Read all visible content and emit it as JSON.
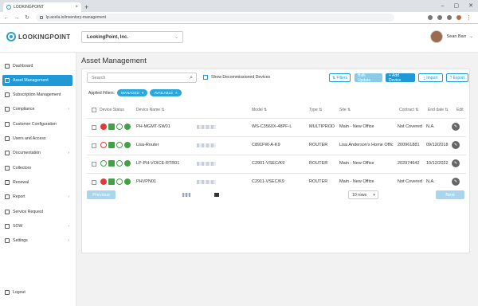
{
  "browser": {
    "tab_title": "LOOKINGPOINT",
    "url": "lp.acela.io/inventory-management",
    "new_tab": "+"
  },
  "header": {
    "logo_text": "LOOKINGPOINT",
    "company": "LookingPoint, Inc.",
    "user_name": "Sean Barr"
  },
  "sidebar": {
    "items": [
      {
        "label": "Dashboard",
        "icon": "dashboard-icon",
        "chevron": false
      },
      {
        "label": "Asset Management",
        "icon": "asset-icon",
        "chevron": false,
        "active": true
      },
      {
        "label": "Subscription Management",
        "icon": "subscription-icon",
        "chevron": false
      },
      {
        "label": "Compliance",
        "icon": "compliance-icon",
        "chevron": true
      },
      {
        "label": "Customer Configuration",
        "icon": "config-icon",
        "chevron": false
      },
      {
        "label": "Users and Access",
        "icon": "users-icon",
        "chevron": false
      },
      {
        "label": "Documentation",
        "icon": "document-icon",
        "chevron": true
      },
      {
        "label": "Collectors",
        "icon": "collectors-icon",
        "chevron": false
      },
      {
        "label": "Renewal",
        "icon": "renewal-icon",
        "chevron": false
      },
      {
        "label": "Report",
        "icon": "report-icon",
        "chevron": true
      },
      {
        "label": "Service Request",
        "icon": "service-icon",
        "chevron": false
      },
      {
        "label": "SOW",
        "icon": "sow-icon",
        "chevron": true
      },
      {
        "label": "Settings",
        "icon": "settings-icon",
        "chevron": true
      }
    ],
    "logout": "Logout"
  },
  "page": {
    "title": "Asset Management"
  },
  "toolbar": {
    "search_placeholder": "Search",
    "show_decommissioned": "Show Decommissioned Devices",
    "filters": "Filters",
    "bulk_update": "Bulk Update",
    "add_device": "+ Add Device",
    "import": "Import",
    "export": "Export"
  },
  "applied_filters": {
    "label": "Applied Filters:",
    "chips": [
      "MANAGED",
      "AVAILABLE"
    ]
  },
  "table": {
    "headers": [
      "Device Status",
      "Device Name ⇅",
      "Model ⇅",
      "Type ⇅",
      "Site ⇅",
      "Contract ⇅",
      "End date ⇅",
      "Edit"
    ],
    "rows": [
      {
        "name": "PH-MGMT-SW01",
        "model": "WS-C3560X-48PF-L",
        "type": "MULTIPROD",
        "site": "Main - New Office",
        "contract": "Not Covered",
        "end": "N.A.",
        "first": "red"
      },
      {
        "name": "Lisa-Router",
        "model": "C891FW-A-K9",
        "type": "ROUTER",
        "site": "Lisa Anderson's Home Offic",
        "contract": "200961881",
        "end": "09/12/2018",
        "first": "redring"
      },
      {
        "name": "LP-PH-VOICE-RTR01",
        "model": "C2901-VSEC/K9",
        "type": "ROUTER",
        "site": "Main - New Office",
        "contract": "202974642",
        "end": "10/12/2022",
        "first": "grnring"
      },
      {
        "name": "PHVPN01",
        "model": "C2911-VSEC/K9",
        "type": "ROUTER",
        "site": "Main - New Office",
        "contract": "Not Covered",
        "end": "N.A.",
        "first": "red"
      }
    ]
  },
  "pagination": {
    "previous": "Previous",
    "rows": "10 rows",
    "next": "Next"
  }
}
